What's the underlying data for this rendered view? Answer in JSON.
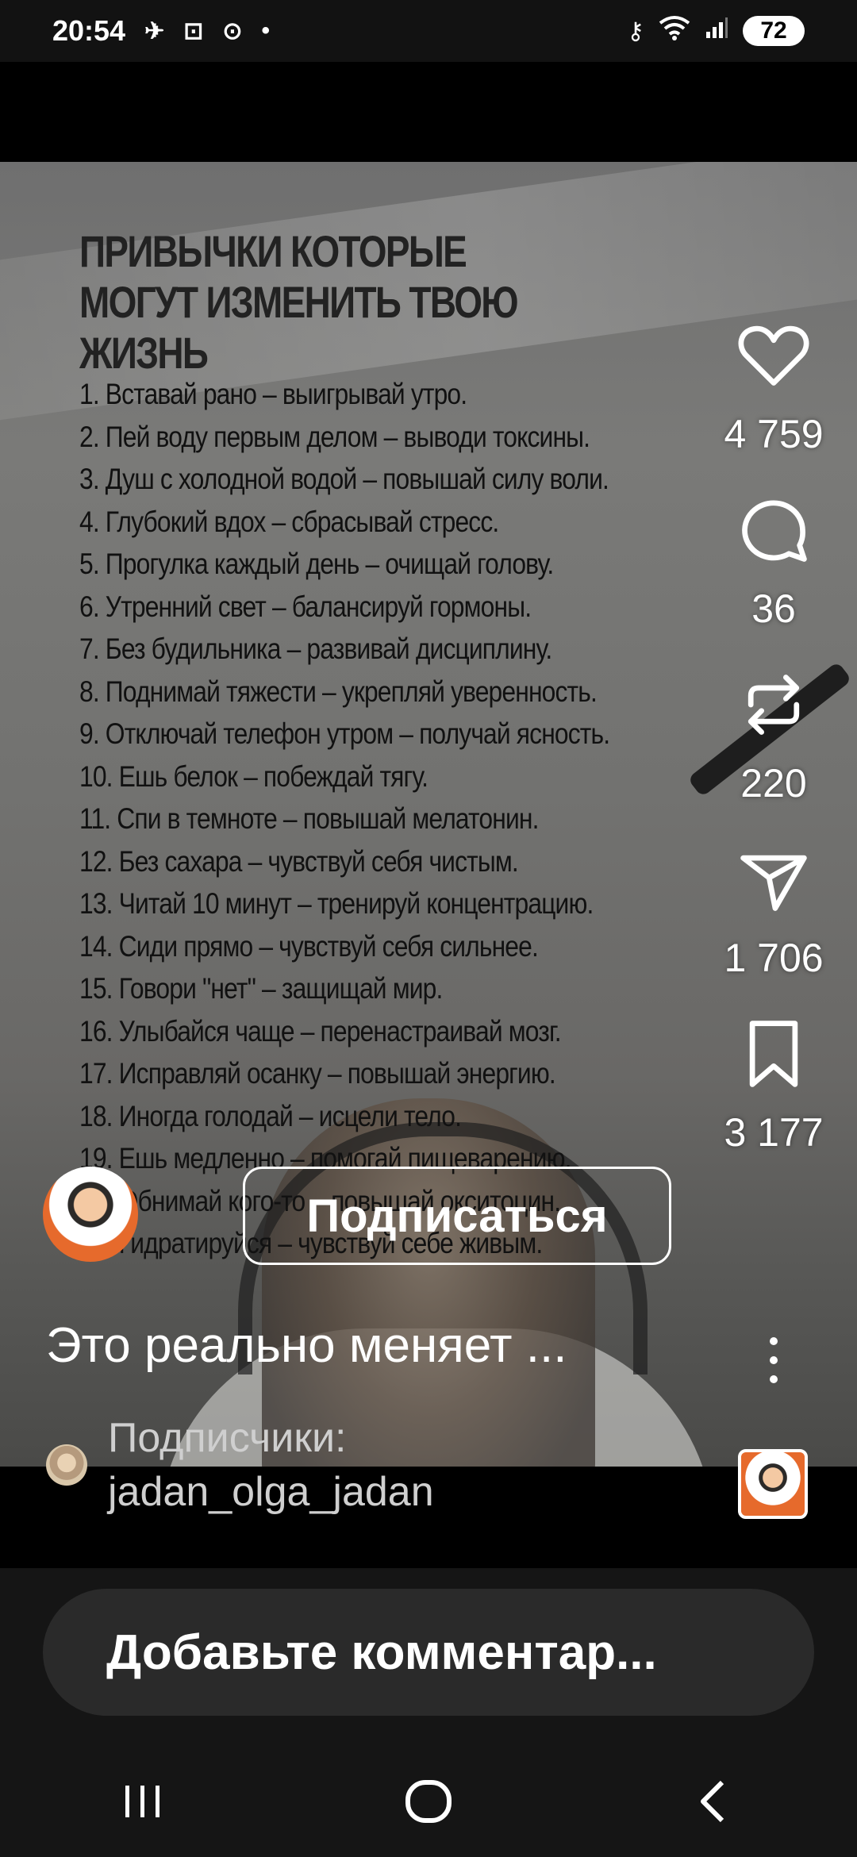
{
  "status_bar": {
    "time": "20:54",
    "battery": "72",
    "icons": [
      "mute-icon",
      "screenshot-icon",
      "vpn-icon",
      "dot-icon",
      "key-icon",
      "wifi-icon",
      "signal-icon",
      "battery-icon"
    ]
  },
  "post": {
    "title": "ПРИВЫЧКИ КОТОРЫЕ МОГУТ ИЗМЕНИТЬ ТВОЮ ЖИЗНЬ",
    "habits": [
      "1. Вставай рано – выигрывай утро.",
      "2. Пей воду первым делом – выводи токсины.",
      "3. Душ с холодной водой – повышай силу воли.",
      "4. Глубокий вдох – сбрасывай стресс.",
      "5. Прогулка каждый день – очищай голову.",
      "6. Утренний свет – балансируй гормоны.",
      "7. Без будильника – развивай дисциплину.",
      "8. Поднимай тяжести – укрепляй уверенность.",
      "9. Отключай телефон утром – получай ясность.",
      "10. Ешь белок – побеждай тягу.",
      "11. Спи в темноте – повышай мелатонин.",
      "12. Без сахара – чувствуй себя чистым.",
      "13. Читай 10 минут – тренируй концентрацию.",
      "14. Сиди прямо – чувствуй себя сильнее.",
      "15. Говори \"нет\" – защищай мир.",
      "16. Улыбайся чаще – перенастраивай мозг.",
      "17. Исправляй осанку – повышай энергию.",
      "18. Иногда голодай – исцели тело.",
      "19. Ешь медленно – помогай пищеварению.",
      "20. Обнимай кого-то – повышай окситоцин.",
      "21. Гидратируйся – чувствуй себе живым."
    ]
  },
  "actions": {
    "likes": "4 759",
    "comments": "36",
    "reposts": "220",
    "shares": "1 706",
    "saves": "3 177"
  },
  "author": {
    "subscribe_label": "Подписаться"
  },
  "caption": "Это реально меняет ...",
  "followers": {
    "label": "Подписчики:",
    "name": "jadan_olga_jadan"
  },
  "comment": {
    "placeholder": "Добавьте комментар..."
  },
  "colors": {
    "accent_orange": "#e66a2c",
    "text": "#ffffff",
    "panel": "#151515"
  }
}
